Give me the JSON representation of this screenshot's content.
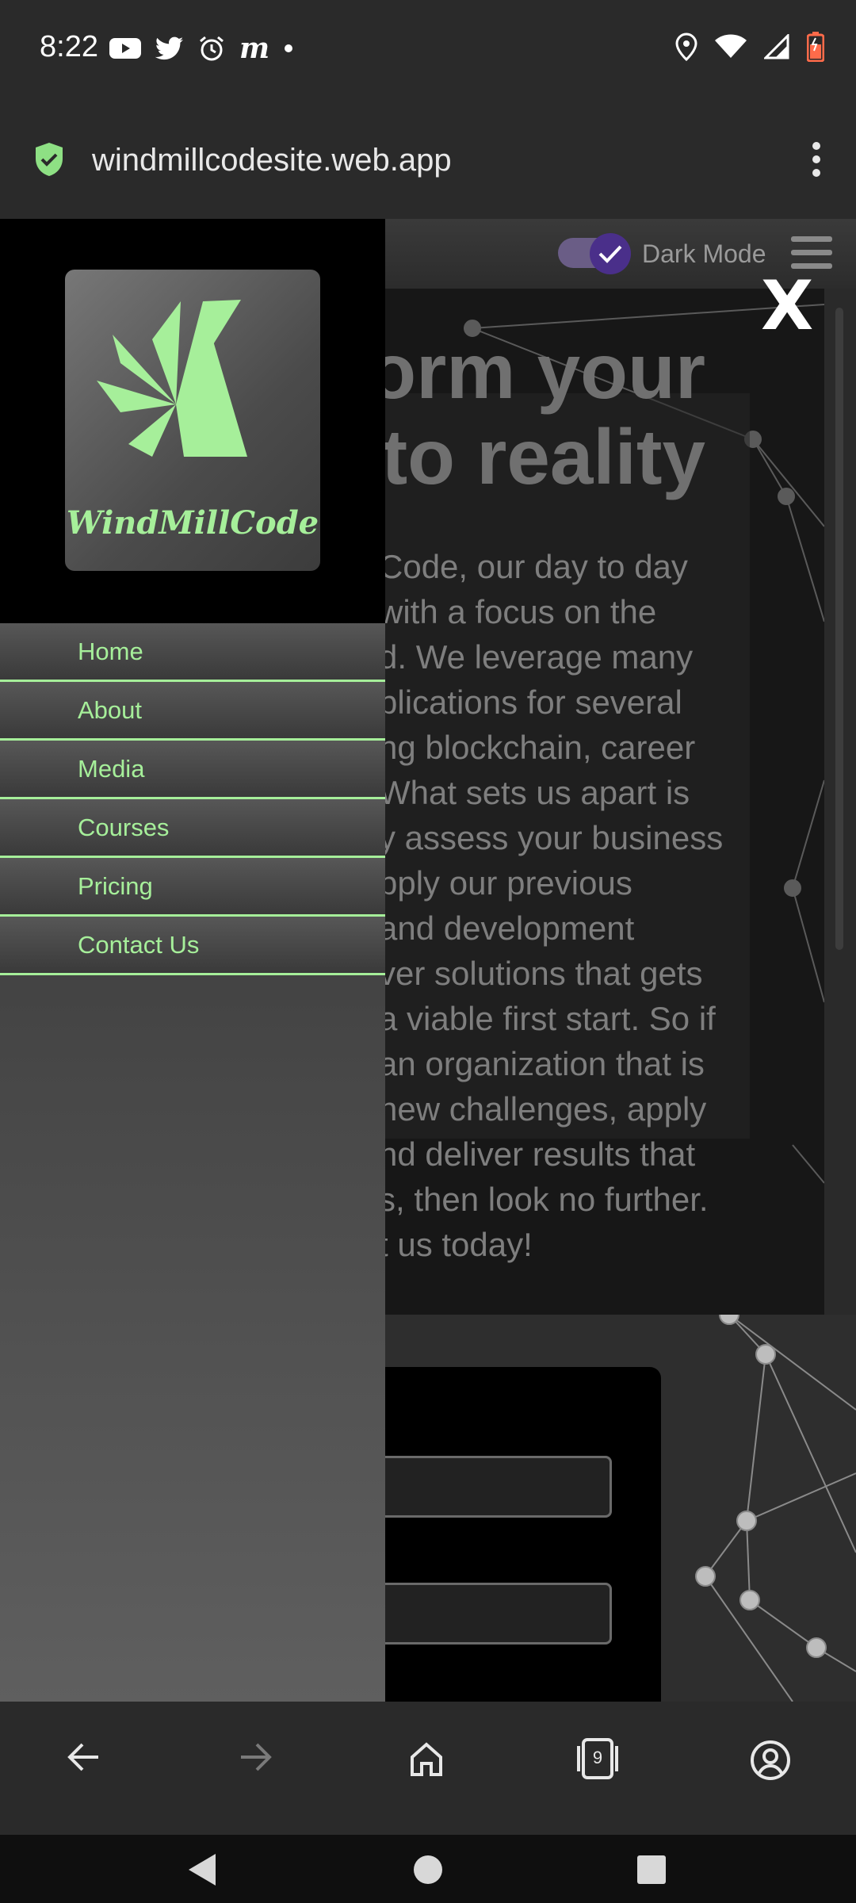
{
  "status_bar": {
    "time": "8:22",
    "left_icons": [
      "youtube-icon",
      "twitter-icon",
      "alarm-icon",
      "m-app-icon",
      "dot-icon"
    ],
    "right_icons": [
      "location-icon",
      "wifi-icon",
      "signal-icon",
      "battery-icon"
    ]
  },
  "browser": {
    "url": "windmillcodesite.web.app",
    "tab_count": "9"
  },
  "site_header": {
    "dark_mode_label": "Dark Mode",
    "dark_mode_on": true
  },
  "hero": {
    "title_lines": [
      "orm your",
      "to reality"
    ],
    "body_lines": [
      "Code, our day to day",
      "with a focus on the",
      "d. We leverage many",
      "plications for several",
      "ng blockchain, career",
      "What sets us apart is",
      "y assess your business",
      "pply our previous",
      "and development",
      "ver solutions that gets",
      "a viable first start. So if",
      "an organization that is",
      "new challenges, apply",
      "nd deliver results that",
      "s, then look no further.",
      "t us today!"
    ],
    "close_label": "X"
  },
  "drawer": {
    "logo_text": "WindMillCode",
    "menu": [
      "Home",
      "About",
      "Media",
      "Courses",
      "Pricing",
      "Contact Us"
    ]
  },
  "colors": {
    "accent_green": "#a6ef9a",
    "toggle_purple": "#4a2f8a"
  }
}
